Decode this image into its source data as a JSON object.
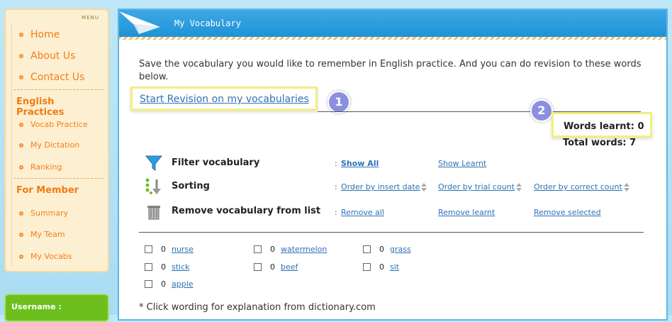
{
  "menu": {
    "tag": "MENU",
    "top_items": [
      "Home",
      "About Us",
      "Contact Us"
    ],
    "practice_title": "English Practices",
    "practice_items": [
      "Vocab Practice",
      "My Dictation",
      "Ranking"
    ],
    "member_title": "For Member",
    "member_items": [
      "Summary",
      "My Team",
      "My Vocabs"
    ]
  },
  "user": {
    "label": "Username :"
  },
  "header": {
    "title": "My Vocabulary"
  },
  "intro": "Save the vocabulary you would like to remember in English practice. And you can do revision to these words below.",
  "revision_link": "Start Revision on my vocabularies",
  "badges": [
    "1",
    "2"
  ],
  "stats": {
    "words_learnt": "Words learnt: 0",
    "total_words": "Total words:   7"
  },
  "filter": {
    "label": "Filter vocabulary",
    "colon": ":",
    "show_all": "Show All",
    "show_learnt": "Show Learnt"
  },
  "sorting": {
    "label": "Sorting",
    "colon": ":",
    "by_insert_date": "Order by insert date",
    "by_trial_count": "Order by trial count",
    "by_correct_count": "Order by correct count"
  },
  "remove": {
    "label": "Remove vocabulary from list",
    "colon": ":",
    "remove_all": "Remove all",
    "remove_learnt": "Remove learnt",
    "remove_selected": "Remove selected"
  },
  "words": [
    {
      "count": "0",
      "word": "nurse"
    },
    {
      "count": "0",
      "word": "watermelon"
    },
    {
      "count": "0",
      "word": "grass"
    },
    {
      "count": "0",
      "word": "stick"
    },
    {
      "count": "0",
      "word": "beef"
    },
    {
      "count": "0",
      "word": "sit"
    },
    {
      "count": "0",
      "word": "apple"
    }
  ],
  "footer": "* Click wording for explanation from dictionary.com"
}
